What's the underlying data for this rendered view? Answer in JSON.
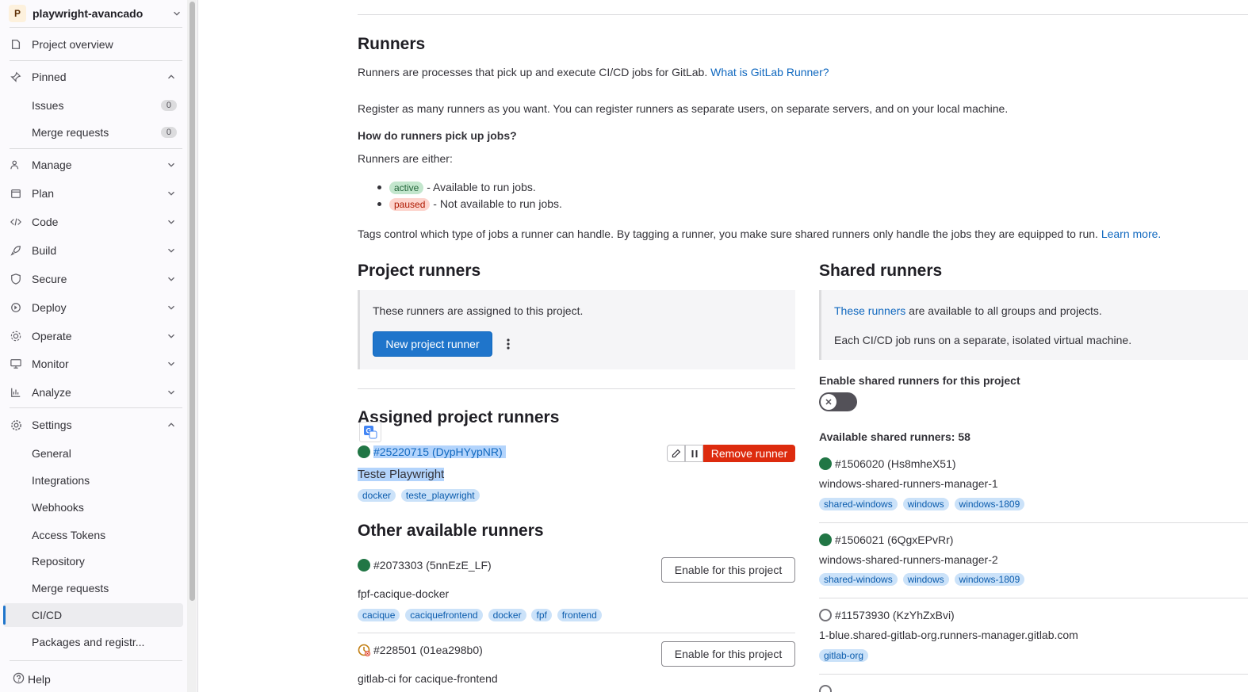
{
  "sidebar": {
    "project_avatar": "P",
    "project_name": "playwright-avancado",
    "overview": "Project overview",
    "pinned": "Pinned",
    "pinned_items": [
      {
        "label": "Issues",
        "count": "0"
      },
      {
        "label": "Merge requests",
        "count": "0"
      }
    ],
    "sections": [
      "Manage",
      "Plan",
      "Code",
      "Build",
      "Secure",
      "Deploy",
      "Operate",
      "Monitor",
      "Analyze"
    ],
    "settings": "Settings",
    "settings_items": [
      "General",
      "Integrations",
      "Webhooks",
      "Access Tokens",
      "Repository",
      "Merge requests",
      "CI/CD",
      "Packages and registr..."
    ],
    "help": "Help"
  },
  "runners": {
    "title": "Runners",
    "intro": "Runners are processes that pick up and execute CI/CD jobs for GitLab.",
    "intro_link": "What is GitLab Runner?",
    "register": "Register as many runners as you want. You can register runners as separate users, on separate servers, and on your local machine.",
    "how_title": "How do runners pick up jobs?",
    "either": "Runners are either:",
    "active_badge": "active",
    "active_text": "- Available to run jobs.",
    "paused_badge": "paused",
    "paused_text": "- Not available to run jobs.",
    "tags_text": "Tags control which type of jobs a runner can handle. By tagging a runner, you make sure shared runners only handle the jobs they are equipped to run.",
    "learn_more": "Learn more."
  },
  "project_runners": {
    "title": "Project runners",
    "box_text": "These runners are assigned to this project.",
    "new_button": "New project runner",
    "assigned_title": "Assigned project runners",
    "assigned": {
      "id": "#25220715 (DypHYypNR)",
      "name": "Teste Playwright",
      "tags": [
        "docker",
        "teste_playwright"
      ],
      "remove_label": "Remove runner"
    },
    "other_title": "Other available runners",
    "others": [
      {
        "id": "#2073303 (5nnEzE_LF)",
        "name": "fpf-cacique-docker",
        "tags": [
          "cacique",
          "caciquefrontend",
          "docker",
          "fpf",
          "frontend"
        ],
        "button": "Enable for this project"
      },
      {
        "id": "#228501 (01ea298b0)",
        "name": "gitlab-ci for cacique-frontend",
        "tags": [],
        "button": "Enable for this project"
      }
    ]
  },
  "shared_runners": {
    "title": "Shared runners",
    "box_link": "These runners",
    "box_text": "are available to all groups and projects.",
    "box_text2": "Each CI/CD job runs on a separate, isolated virtual machine.",
    "enable_label": "Enable shared runners for this project",
    "enabled": false,
    "available": "Available shared runners: 58",
    "list": [
      {
        "id": "#1506020 (Hs8mheX51)",
        "name": "windows-shared-runners-manager-1",
        "tags": [
          "shared-windows",
          "windows",
          "windows-1809"
        ],
        "online": true
      },
      {
        "id": "#1506021 (6QgxEPvRr)",
        "name": "windows-shared-runners-manager-2",
        "tags": [
          "shared-windows",
          "windows",
          "windows-1809"
        ],
        "online": true
      },
      {
        "id": "#11573930 (KzYhZxBvi)",
        "name": "1-blue.shared-gitlab-org.runners-manager.gitlab.com",
        "tags": [
          "gitlab-org"
        ],
        "online": false
      }
    ]
  }
}
